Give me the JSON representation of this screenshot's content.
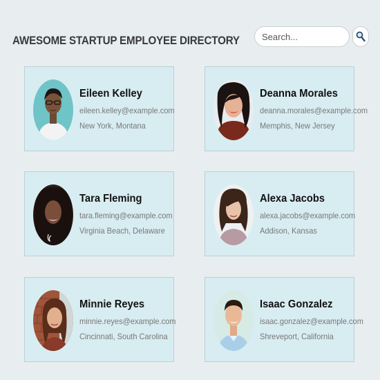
{
  "header": {
    "title": "AWESOME STARTUP EMPLOYEE DIRECTORY"
  },
  "search": {
    "placeholder": "Search...",
    "value": "",
    "icon": "magnifier-icon"
  },
  "colors": {
    "page_background": "#e8eef0",
    "card_background": "#d8edf2",
    "card_border": "#b9cfd6"
  },
  "employees": [
    {
      "name": "Eileen Kelley",
      "email": "eileen.kelley@example.com",
      "location": "New York, Montana"
    },
    {
      "name": "Deanna Morales",
      "email": "deanna.morales@example.com",
      "location": "Memphis, New Jersey"
    },
    {
      "name": "Tara Fleming",
      "email": "tara.fleming@example.com",
      "location": "Virginia Beach, Delaware"
    },
    {
      "name": "Alexa Jacobs",
      "email": "alexa.jacobs@example.com",
      "location": "Addison, Kansas"
    },
    {
      "name": "Minnie Reyes",
      "email": "minnie.reyes@example.com",
      "location": "Cincinnati, South Carolina"
    },
    {
      "name": "Isaac Gonzalez",
      "email": "isaac.gonzalez@example.com",
      "location": "Shreveport, California"
    }
  ]
}
